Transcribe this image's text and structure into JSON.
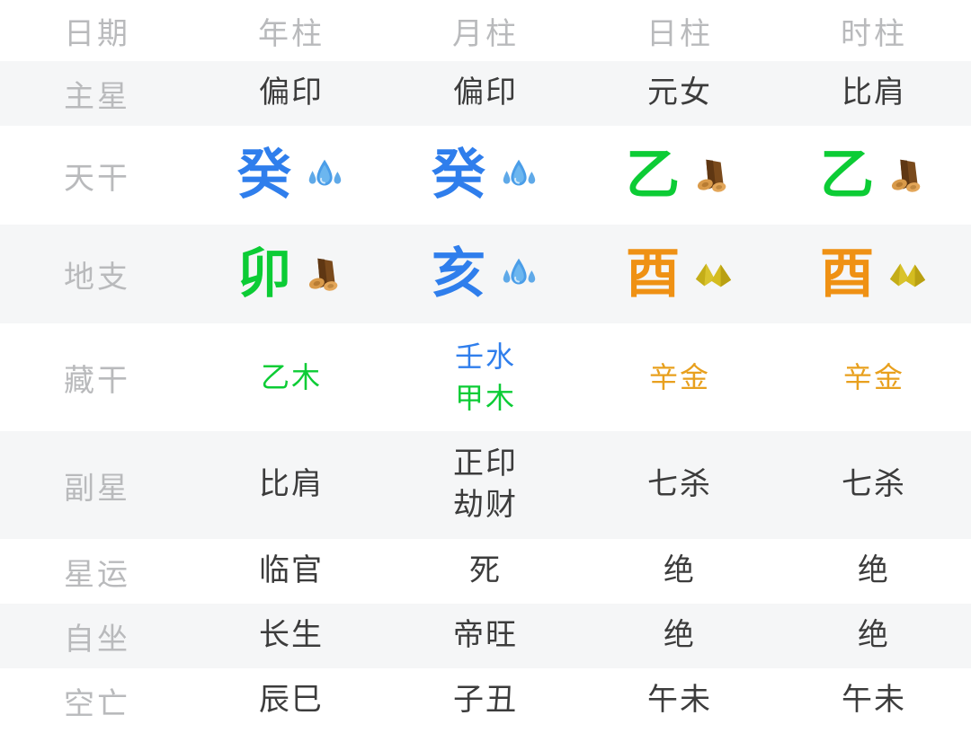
{
  "table": {
    "columns": [
      {
        "key": "label",
        "label": "日期"
      },
      {
        "key": "year",
        "label": "年柱"
      },
      {
        "key": "month",
        "label": "月柱"
      },
      {
        "key": "day",
        "label": "日柱"
      },
      {
        "key": "hour",
        "label": "时柱"
      }
    ],
    "rows": {
      "zhuxing": {
        "label": "主星",
        "year": "偏印",
        "month": "偏印",
        "day": "元女",
        "hour": "比肩"
      },
      "tiangan": {
        "label": "天干",
        "cells": [
          {
            "glyph": "癸",
            "element": "water",
            "icon": "water-droplet-icon",
            "color": "#2f7eec"
          },
          {
            "glyph": "癸",
            "element": "water",
            "icon": "water-droplet-icon",
            "color": "#2f7eec"
          },
          {
            "glyph": "乙",
            "element": "wood",
            "icon": "wood-log-icon",
            "color": "#0ccc35"
          },
          {
            "glyph": "乙",
            "element": "wood",
            "icon": "wood-log-icon",
            "color": "#0ccc35"
          }
        ]
      },
      "dizhi": {
        "label": "地支",
        "cells": [
          {
            "glyph": "卯",
            "element": "wood",
            "icon": "wood-log-icon",
            "color": "#0ccc35"
          },
          {
            "glyph": "亥",
            "element": "water",
            "icon": "water-droplet-icon",
            "color": "#2f7eec"
          },
          {
            "glyph": "酉",
            "element": "metal",
            "icon": "metal-nugget-icon",
            "color": "#ef9114"
          },
          {
            "glyph": "酉",
            "element": "metal",
            "icon": "metal-nugget-icon",
            "color": "#ef9114"
          }
        ]
      },
      "canggan": {
        "label": "藏干",
        "cells": [
          {
            "lines": [
              {
                "text": "乙木",
                "element": "wood"
              }
            ]
          },
          {
            "lines": [
              {
                "text": "壬水",
                "element": "water"
              },
              {
                "text": "甲木",
                "element": "wood"
              }
            ]
          },
          {
            "lines": [
              {
                "text": "辛金",
                "element": "metal"
              }
            ]
          },
          {
            "lines": [
              {
                "text": "辛金",
                "element": "metal"
              }
            ]
          }
        ]
      },
      "fuxing": {
        "label": "副星",
        "cells": [
          {
            "lines": [
              "比肩"
            ]
          },
          {
            "lines": [
              "正印",
              "劫财"
            ]
          },
          {
            "lines": [
              "七杀"
            ]
          },
          {
            "lines": [
              "七杀"
            ]
          }
        ]
      },
      "xingyun": {
        "label": "星运",
        "year": "临官",
        "month": "死",
        "day": "绝",
        "hour": "绝"
      },
      "zizuo": {
        "label": "自坐",
        "year": "长生",
        "month": "帝旺",
        "day": "绝",
        "hour": "绝"
      },
      "kongwang": {
        "label": "空亡",
        "year": "辰巳",
        "month": "子丑",
        "day": "午未",
        "hour": "午未"
      }
    }
  },
  "theme": {
    "wood": "#0ccc35",
    "water": "#2f7eec",
    "metal": "#ef9114",
    "stem_metal": "#e8a01e",
    "label_gray": "#b9babc",
    "text_dark": "#3c3c3c",
    "stripe_bg": "#f5f6f7",
    "page_bg": "#ffffff"
  }
}
